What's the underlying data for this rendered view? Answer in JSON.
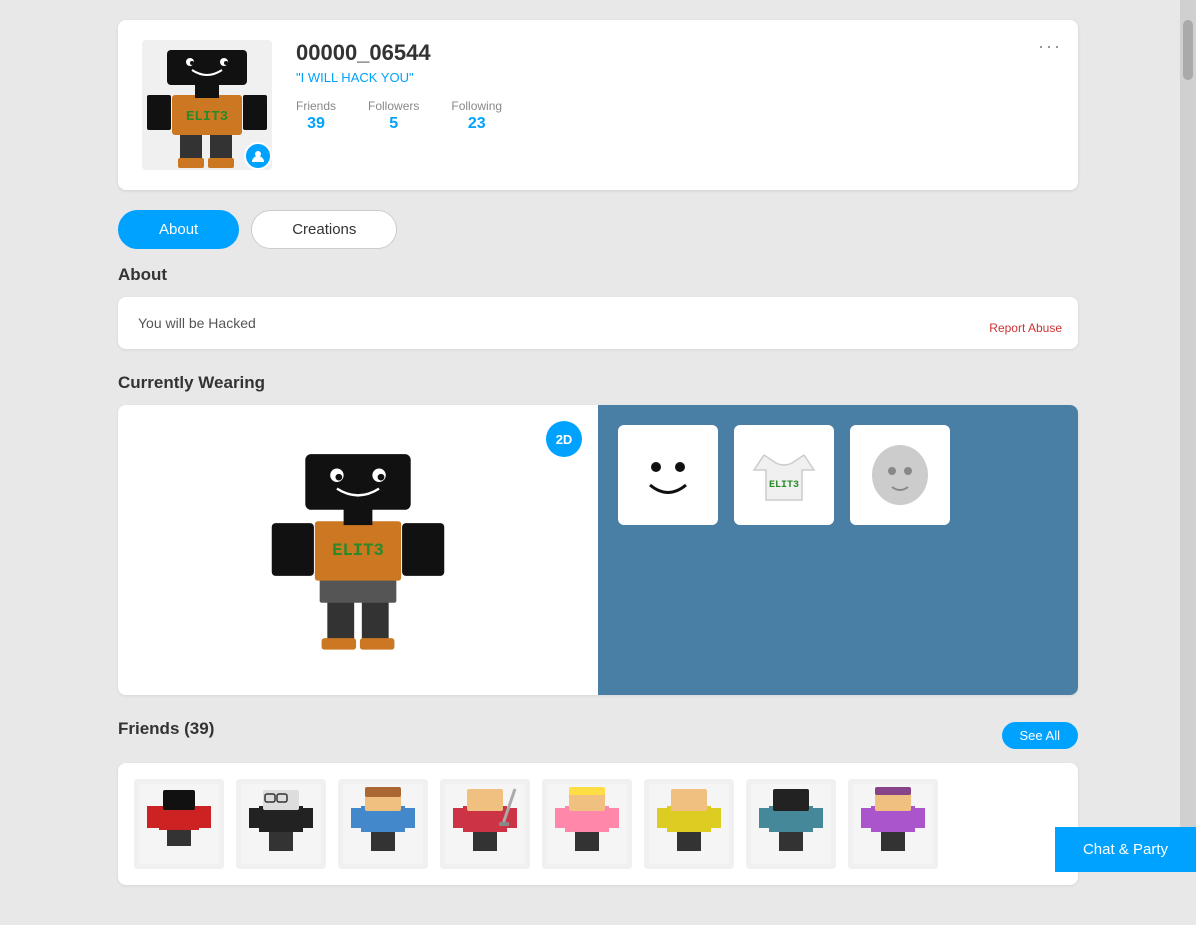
{
  "profile": {
    "username": "00000_06544",
    "tagline": "\"I WILL HACK YOU\"",
    "stats": {
      "friends_label": "Friends",
      "friends_value": "39",
      "followers_label": "Followers",
      "followers_value": "5",
      "following_label": "Following",
      "following_value": "23"
    }
  },
  "more_menu": "···",
  "tabs": {
    "about_label": "About",
    "creations_label": "Creations"
  },
  "about": {
    "section_title": "About",
    "description": "You will be Hacked",
    "report_abuse": "Report Abuse"
  },
  "currently_wearing": {
    "section_title": "Currently Wearing",
    "badge_2d": "2D"
  },
  "friends": {
    "section_title": "Friends (39)",
    "see_all_label": "See All"
  },
  "chat_party": {
    "label": "Chat & Party"
  },
  "colors": {
    "blue": "#00a2ff",
    "dark_blue_bg": "#4a7fa5",
    "red_report": "#cc3333"
  }
}
